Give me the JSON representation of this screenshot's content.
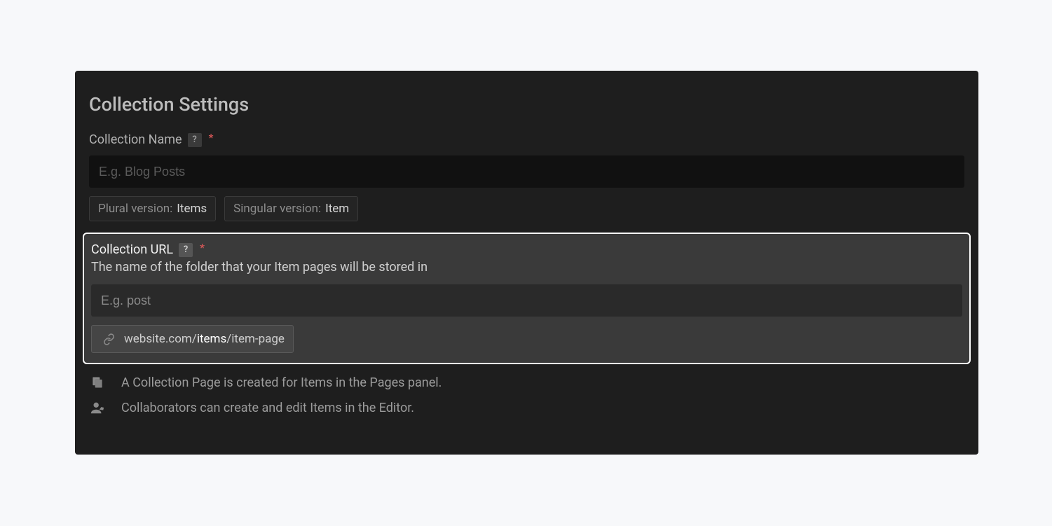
{
  "title": "Collection Settings",
  "name_field": {
    "label": "Collection Name",
    "placeholder": "E.g. Blog Posts",
    "plural_label": "Plural version:",
    "plural_value": "Items",
    "singular_label": "Singular version:",
    "singular_value": "Item"
  },
  "url_field": {
    "label": "Collection URL",
    "help_text": "The name of the folder that your Item pages will be stored in",
    "placeholder": "E.g. post",
    "preview_prefix": "website.com/",
    "preview_bold": "items",
    "preview_suffix": "/item-page"
  },
  "help_badge": "?",
  "req_mark": "*",
  "info": {
    "page_line": "A Collection Page is created for Items in the Pages panel.",
    "collab_line": "Collaborators can create and edit Items in the Editor."
  }
}
